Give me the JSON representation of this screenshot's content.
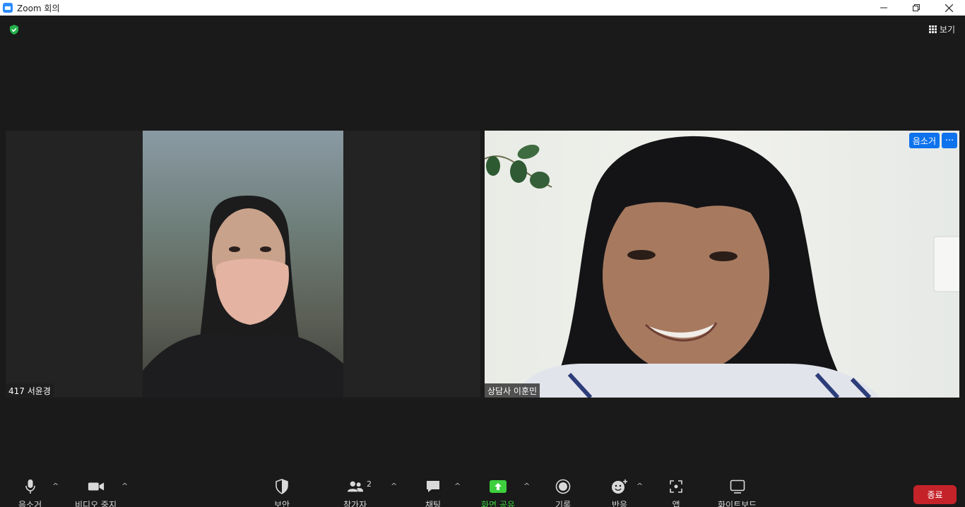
{
  "window": {
    "title": "Zoom 회의",
    "minimize_icon": "minimize-icon",
    "restore_icon": "restore-icon",
    "close_icon": "close-icon"
  },
  "header": {
    "view_label": "보기",
    "security_icon": "shield-check-icon"
  },
  "participants": [
    {
      "name": "417 서윤경"
    },
    {
      "name": "상담사 이훈민",
      "badge": "음소거",
      "more": "···"
    }
  ],
  "toolbar": {
    "mute_label": "음소거",
    "video_label": "비디오 중지",
    "security_label": "보안",
    "participants_label": "참가자",
    "participants_count": "2",
    "chat_label": "채팅",
    "share_label": "화면 공유",
    "record_label": "기록",
    "reactions_label": "반응",
    "apps_label": "앱",
    "whiteboard_label": "화이트보드",
    "end_label": "종료",
    "caret": "^"
  },
  "colors": {
    "accent": "#0e72ed",
    "share_green": "#3ecf3e",
    "end_red": "#c5232a",
    "background": "#1a1a1a"
  }
}
